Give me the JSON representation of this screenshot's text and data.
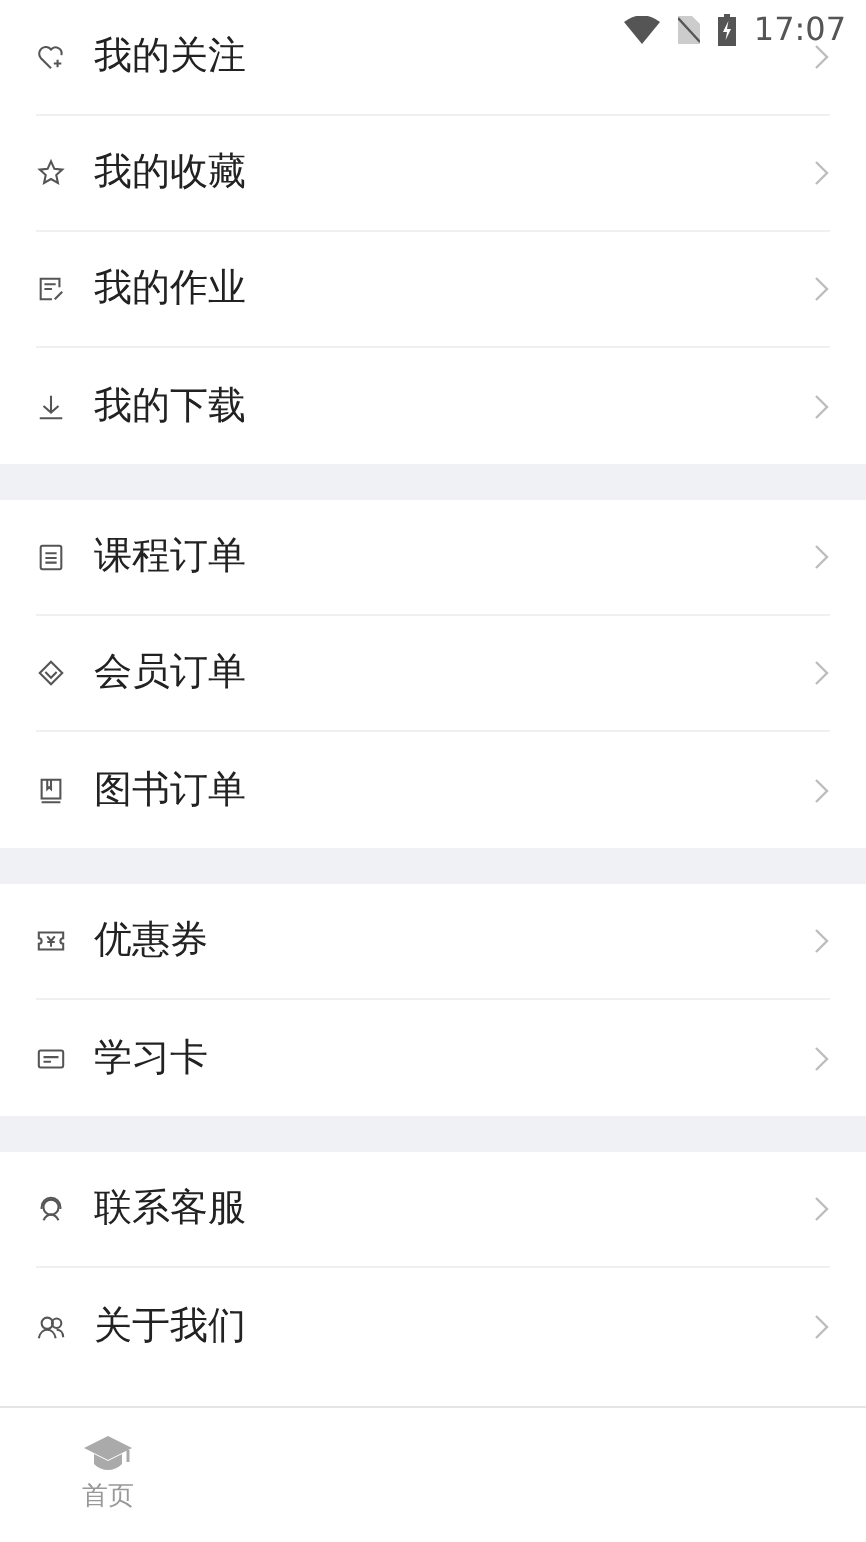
{
  "status_bar": {
    "time": "17:07"
  },
  "groups": [
    {
      "items": [
        {
          "label": "我的关注"
        },
        {
          "label": "我的收藏"
        },
        {
          "label": "我的作业"
        },
        {
          "label": "我的下载"
        }
      ]
    },
    {
      "items": [
        {
          "label": "课程订单"
        },
        {
          "label": "会员订单"
        },
        {
          "label": "图书订单"
        }
      ]
    },
    {
      "items": [
        {
          "label": "优惠券"
        },
        {
          "label": "学习卡"
        }
      ]
    },
    {
      "items": [
        {
          "label": "联系客服"
        },
        {
          "label": "关于我们"
        }
      ]
    }
  ],
  "tab_bar": [
    {
      "label": "首页",
      "selected": false
    }
  ]
}
